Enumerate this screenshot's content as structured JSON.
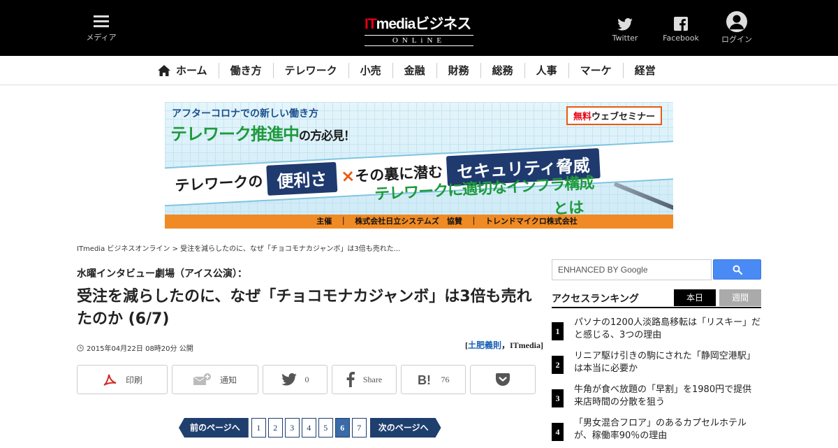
{
  "header": {
    "menu_label": "メディア",
    "logo_main_red": "IT",
    "logo_main_white": "mediaビジネス",
    "logo_sub": "ONLiNE",
    "twitter_label": "Twitter",
    "facebook_label": "Facebook",
    "login_label": "ログイン"
  },
  "nav": {
    "items": [
      "ホーム",
      "働き方",
      "テレワーク",
      "小売",
      "金融",
      "財務",
      "総務",
      "人事",
      "マーケ",
      "経営"
    ]
  },
  "banner": {
    "line1": "アフターコロナでの新しい働き方",
    "line2_main": "テレワーク推進中",
    "line2_sub": "の方必見！",
    "seminar_free": "無料",
    "seminar_rest": "ウェブセミナー",
    "row_a": "テレワークの",
    "box_a": "便利さ",
    "cross": "×",
    "row_b": "その裏に潜む",
    "box_b": "セキュリティ脅威",
    "line4": "テレワークに適切なインフラ構成",
    "line5": "とは",
    "footer": "主催　｜　株式会社日立システムズ　協賛　｜　トレンドマイクロ株式会社"
  },
  "breadcrumb": {
    "home": "ITmedia ビジネスオンライン",
    "sep": " > ",
    "current": "受注を減らしたのに、なぜ「チョコモナカジャンボ」は3倍も売れた..."
  },
  "article": {
    "kicker": "水曜インタビュー劇場（アイス公演）：",
    "title": "受注を減らしたのに、なぜ「チョコモナカジャンボ」は3倍も売れたのか (6/7)",
    "date": "2015年04月22日 08時20分 公開",
    "author_open": "[",
    "author_name": "土肥義則",
    "author_rest": "，ITmedia]"
  },
  "share": {
    "print": "印刷",
    "notify": "通知",
    "twitter_count": "0",
    "facebook": "Share",
    "hatena_count": "76"
  },
  "pager": {
    "prev": "前のページへ",
    "next": "次のページへ",
    "pages": [
      "1",
      "2",
      "3",
      "4",
      "5",
      "6",
      "7"
    ],
    "current": "6"
  },
  "sidebar": {
    "search_placeholder": "ENHANCED BY Google",
    "ranking_title": "アクセスランキング",
    "tab_today": "本日",
    "tab_week": "週間",
    "ranking": [
      {
        "num": "1",
        "text": "パソナの1200人淡路島移転は「リスキー」だと感じる、3つの理由"
      },
      {
        "num": "2",
        "text": "リニア駆け引きの駒にされた「静岡空港駅」は本当に必要か"
      },
      {
        "num": "3",
        "text": "牛角が食べ放題の「早割」を1980円で提供　来店時間の分散を狙う"
      },
      {
        "num": "4",
        "text": "「男女混合フロア」のあるカプセルホテルが、稼働率90％の理由"
      }
    ]
  },
  "colors": {
    "topbar": "#000000",
    "brand_red": "#e60012",
    "pager_blue": "#1f3f6e",
    "pager_current": "#3a6aa8",
    "google_btn": "#4a8af4"
  }
}
